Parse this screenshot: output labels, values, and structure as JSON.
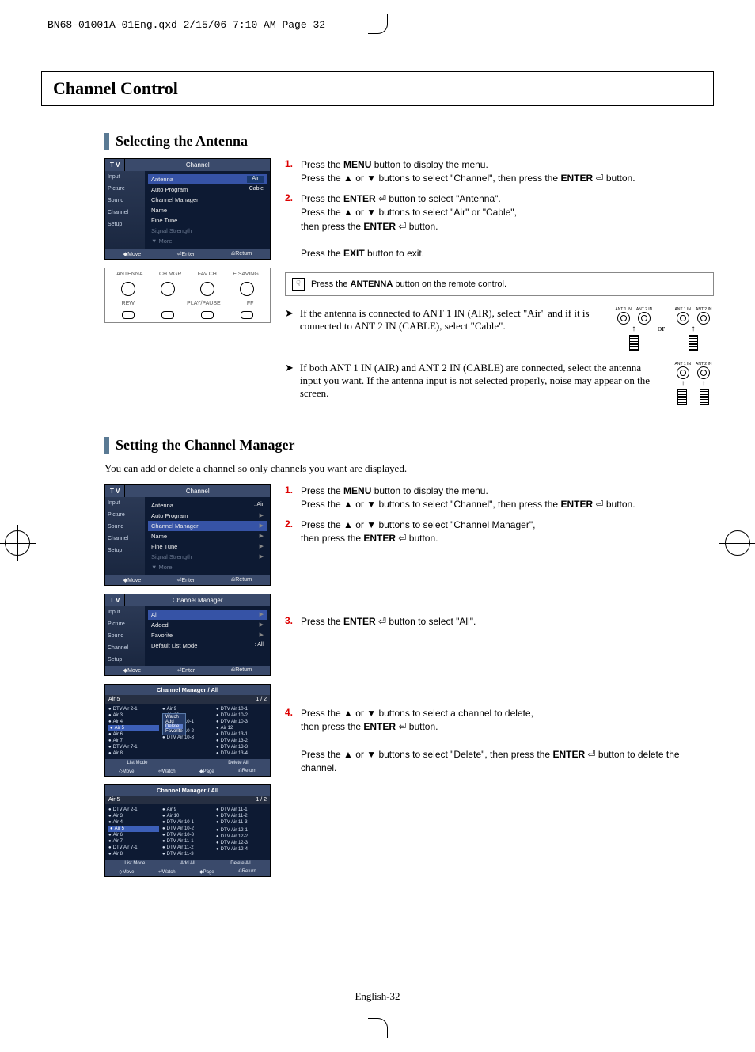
{
  "header_line": "BN68-01001A-01Eng.qxd  2/15/06  7:10 AM  Page 32",
  "page_title": "Channel Control",
  "page_footer": "English-32",
  "section1": {
    "heading": "Selecting the Antenna",
    "osd": {
      "tv": "T V",
      "title": "Channel",
      "side": [
        "Input",
        "Picture",
        "Sound",
        "Channel",
        "Setup"
      ],
      "rows": [
        {
          "label": "Antenna",
          "value": "Air",
          "sel": true
        },
        {
          "label": "Auto Program",
          "value": "Cable"
        },
        {
          "label": "Channel Manager"
        },
        {
          "label": "Name"
        },
        {
          "label": "Fine Tune"
        },
        {
          "label": "Signal Strength",
          "dim": true
        },
        {
          "label": "▼ More",
          "dim": true
        }
      ],
      "footer": [
        "◆Move",
        "⏎Enter",
        "⎌Return"
      ]
    },
    "remote": {
      "row1": [
        "ANTENNA",
        "CH MGR",
        "FAV.CH",
        "E.SAVING"
      ],
      "row2": [
        "REW",
        "",
        "PLAY/PAUSE",
        "FF"
      ]
    },
    "steps": [
      {
        "n": "1.",
        "body": "Press the <b>MENU</b> button to display the menu.<br>Press the ▲ or ▼ buttons to select \"Channel\", then press the <b>ENTER</b> ⏎ button."
      },
      {
        "n": "2.",
        "body": "Press the <b>ENTER</b> ⏎ button to select \"Antenna\".<br>Press the ▲ or ▼ buttons to select \"Air\" or \"Cable\",<br>then press the <b>ENTER</b> ⏎ button.<br><br>Press the <b>EXIT</b> button to exit."
      }
    ],
    "note": "Press the <b>ANTENNA</b> button on the remote control.",
    "bullets": [
      "If the antenna is connected to ANT 1 IN (AIR), select  \"Air\" and if it is connected to ANT 2 IN (CABLE), select \"Cable\".",
      "If both ANT 1 IN (AIR) and ANT 2 IN (CABLE) are connected, select the antenna input you want. If the antenna input is not selected properly, noise may appear on the screen."
    ],
    "or": "or",
    "ant_labels": {
      "a": "ANT 1 IN",
      "b": "ANT 2 IN"
    }
  },
  "section2": {
    "heading": "Setting the Channel Manager",
    "intro": "You can add or delete a channel so only channels you want are displayed.",
    "osd1": {
      "tv": "T V",
      "title": "Channel",
      "side": [
        "Input",
        "Picture",
        "Sound",
        "Channel",
        "Setup"
      ],
      "rows": [
        {
          "label": "Antenna",
          "value": ": Air",
          "arrow": true
        },
        {
          "label": "Auto Program",
          "arrow": true
        },
        {
          "label": "Channel Manager",
          "sel": true,
          "arrow": true
        },
        {
          "label": "Name",
          "arrow": true
        },
        {
          "label": "Fine Tune",
          "arrow": true
        },
        {
          "label": "Signal Strength",
          "dim": true,
          "arrow": true
        },
        {
          "label": "▼ More",
          "dim": true
        }
      ],
      "footer": [
        "◆Move",
        "⏎Enter",
        "⎌Return"
      ]
    },
    "osd2": {
      "tv": "T V",
      "title": "Channel Manager",
      "side": [
        "Input",
        "Picture",
        "Sound",
        "Channel",
        "Setup"
      ],
      "rows": [
        {
          "label": "All",
          "sel": true,
          "arrow": true
        },
        {
          "label": "Added",
          "arrow": true
        },
        {
          "label": "Favorite",
          "arrow": true
        },
        {
          "label": "Default List Mode",
          "value": ": All",
          "arrow": true
        }
      ],
      "footer": [
        "◆Move",
        "⏎Enter",
        "⎌Return"
      ]
    },
    "chlist1": {
      "title": "Channel Manager / All",
      "current": "Air 5",
      "page": "1 / 2",
      "cols": [
        [
          "DTV Air 2-1",
          "Air 3",
          "Air 4",
          "Air 5",
          "Air 6",
          "Air 7",
          "DTV Air 7-1",
          "Air 8"
        ],
        [
          "Air 9",
          "Air 10",
          "DTV Air 10-1",
          "",
          "",
          "DTV Air 10-2",
          "DTV Air 10-3"
        ],
        [
          "DTV Air 10-1",
          "DTV Air 10-2",
          "DTV Air 10-3",
          "Air 12",
          "DTV Air 13-1",
          "DTV Air 13-2",
          "DTV Air 13-3",
          "DTV Air 13-4"
        ]
      ],
      "popup": [
        "Watch",
        "Add",
        "Delete",
        "Favorite"
      ],
      "popup_sel": "Delete",
      "footer_top": [
        "List Mode",
        "",
        "Delete All"
      ],
      "footer": [
        "◇Move",
        "⏎Watch",
        "◆Page",
        "⎌Return"
      ]
    },
    "chlist2": {
      "title": "Channel Manager / All",
      "current": "Air 5",
      "page": "1 / 2",
      "cols": [
        [
          "DTV Air 2-1",
          "Air 3",
          "Air 4",
          "Air 5",
          "Air 6",
          "Air 7",
          "DTV Air 7-1",
          "Air 8"
        ],
        [
          "Air 9",
          "Air 10",
          "DTV Air 10-1",
          "DTV Air 10-2",
          "DTV Air 10-3",
          "DTV Air 11-1",
          "DTV Air 11-2",
          "DTV Air 11-3"
        ],
        [
          "DTV Air 11-1",
          "DTV Air 11-2",
          "DTV Air 11-3",
          "",
          "DTV Air 12-1",
          "DTV Air 12-2",
          "DTV Air 12-3",
          "DTV Air 12-4"
        ]
      ],
      "footer_top": [
        "List Mode",
        "Add All",
        "Delete All"
      ],
      "footer": [
        "◇Move",
        "⏎Watch",
        "◆Page",
        "⎌Return"
      ]
    },
    "steps": [
      {
        "n": "1.",
        "body": "Press the <b>MENU</b> button to display the menu.<br>Press the ▲ or ▼ buttons to select \"Channel\", then press the <b>ENTER</b> ⏎ button."
      },
      {
        "n": "2.",
        "body": "Press the ▲ or ▼ buttons to select \"Channel Manager\",<br>then press the <b>ENTER</b> ⏎ button."
      },
      {
        "n": "3.",
        "body": "Press the <b>ENTER</b> ⏎ button to select \"All\"."
      },
      {
        "n": "4.",
        "body": "Press the ▲ or ▼ buttons to select a channel to delete,<br>then press the <b>ENTER</b> ⏎ button.<br><br>Press the ▲ or ▼ buttons to select \"Delete\", then press the <b>ENTER</b> ⏎ button to delete the channel."
      }
    ]
  }
}
